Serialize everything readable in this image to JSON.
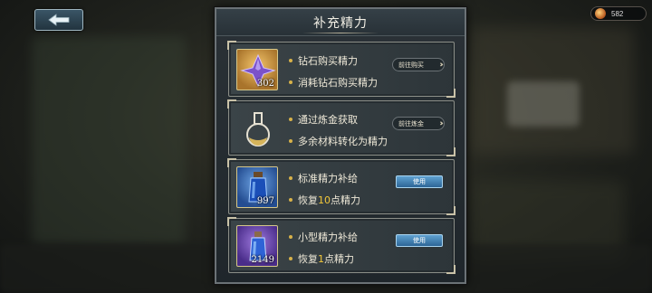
{
  "panel": {
    "title": "补充精力"
  },
  "currency": {
    "value": "582",
    "icon": "energy-coin-icon"
  },
  "back_button": {
    "icon": "back-arrow-icon"
  },
  "items": [
    {
      "icon": "purple-diamond-icon",
      "count": "302",
      "title": "钻石购买精力",
      "desc": "消耗钻石购买精力",
      "button": "前往购买"
    },
    {
      "icon": "alchemy-flask-icon",
      "title": "通过炼金获取",
      "desc": "多余材料转化为精力",
      "button": "前往炼金"
    },
    {
      "icon": "blue-potion-icon",
      "count": "997",
      "title": "标准精力补给",
      "desc_prefix": "恢复",
      "desc_value": "10",
      "desc_suffix": "点精力",
      "button": "使用"
    },
    {
      "icon": "small-purple-potion-icon",
      "count": "2149",
      "title": "小型精力补给",
      "desc_prefix": "恢复",
      "desc_value": "1",
      "desc_suffix": "点精力",
      "button": "使用"
    }
  ],
  "colors": {
    "accent_gold": "#f2c83a",
    "use_button": "#4a8ec0"
  }
}
